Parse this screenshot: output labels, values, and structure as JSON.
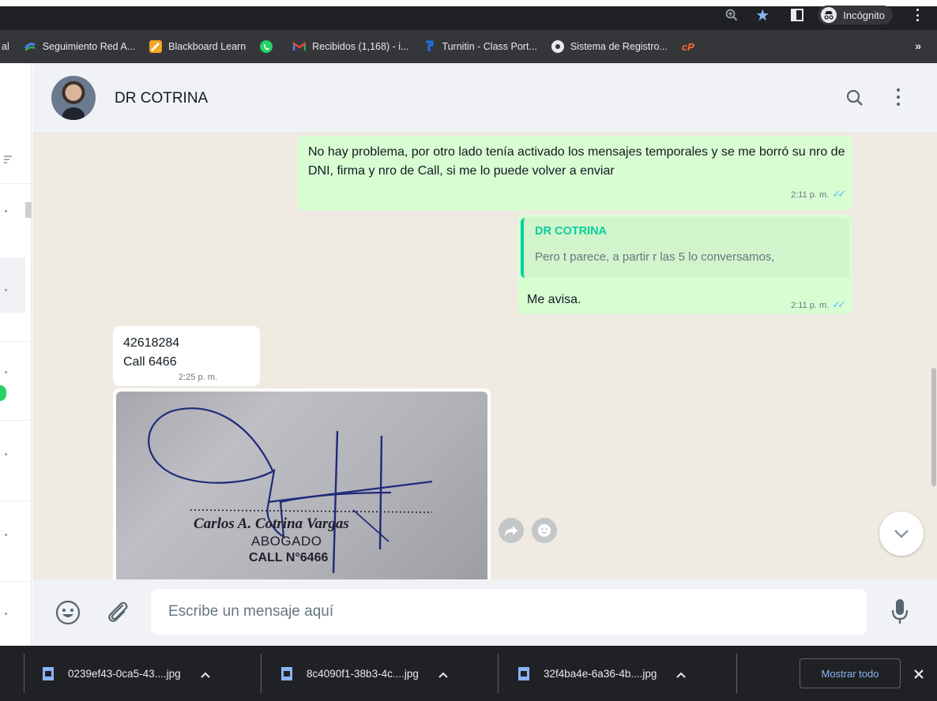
{
  "browser": {
    "incognito_label": "Incógnito",
    "zoom_icon": "zoom-icon",
    "star_icon": "star-icon",
    "colors": {
      "dark_bg": "#202124",
      "bookmark_bg": "#35363a",
      "accent": "#8ab4f8"
    }
  },
  "bookmarks": {
    "cut_label": "al",
    "items": [
      {
        "label": "Seguimiento Red A...",
        "icon": "red-a-icon",
        "color": "#4285f4"
      },
      {
        "label": "Blackboard Learn",
        "icon": "blackboard-icon",
        "color": "#f5a623"
      },
      {
        "label": "",
        "icon": "whatsapp-icon",
        "color": "#25d366"
      },
      {
        "label": "Recibidos (1,168) - i...",
        "icon": "gmail-icon",
        "color": "#ea4335"
      },
      {
        "label": "Turnitin - Class Port...",
        "icon": "turnitin-icon",
        "color": "#1a73e8"
      },
      {
        "label": "Sistema de Registro...",
        "icon": "registro-icon",
        "color": "#e8eaed"
      },
      {
        "label": "",
        "icon": "cpanel-icon",
        "color": "#ff6c2c"
      }
    ],
    "more_label": "»"
  },
  "chat": {
    "contact_name": "DR COTRINA",
    "messages": [
      {
        "direction": "out",
        "text": "No hay problema, por otro lado tenía activado los mensajes temporales y se me borró su nro de DNI, firma y nro de Call, si me lo puede volver a enviar",
        "time": "2:11 p. m."
      },
      {
        "direction": "out",
        "quoted_name": "DR COTRINA",
        "quoted_text": "Pero t parece, a partir r las 5 lo conversamos,",
        "text": "Me avisa.",
        "time": "2:11 p. m."
      },
      {
        "direction": "in",
        "line1": "42618284",
        "line2": "Call 6466",
        "time": "2:25 p. m."
      },
      {
        "direction": "in",
        "type": "image",
        "stamp_name": "Carlos A. Cotrina Vargas",
        "stamp_title": "ABOGADO",
        "stamp_call": "CALL N°6466"
      }
    ],
    "colors": {
      "bg": "#efeae2",
      "outgoing": "#d9fdd3",
      "incoming": "#ffffff",
      "quote_accent": "#06cf9c",
      "read_ticks": "#53bdeb"
    }
  },
  "composer": {
    "placeholder": "Escribe un mensaje aquí",
    "value": ""
  },
  "downloads": {
    "items": [
      {
        "filename": "0239ef43-0ca5-43....jpg"
      },
      {
        "filename": "8c4090f1-38b3-4c....jpg"
      },
      {
        "filename": "32f4ba4e-6a36-4b....jpg"
      }
    ],
    "show_all_label": "Mostrar todo"
  }
}
